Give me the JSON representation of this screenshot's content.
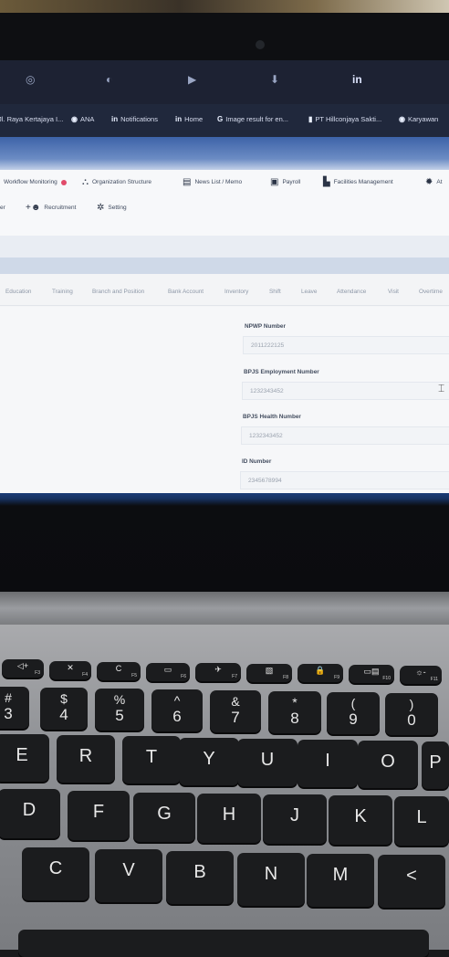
{
  "bookmarks": [
    {
      "icon": "pin-icon",
      "label": "Jl. Raya Kertajaya I..."
    },
    {
      "icon": "globe-icon",
      "label": "ANA"
    },
    {
      "icon": "linkedin-icon",
      "label": "Notifications"
    },
    {
      "icon": "linkedin-icon",
      "label": "Home"
    },
    {
      "icon": "google-icon",
      "label": "Image result for en..."
    },
    {
      "icon": "app-icon",
      "label": "PT Hillconjaya Sakti..."
    },
    {
      "icon": "globe-icon",
      "label": "Karyawan"
    }
  ],
  "menu": {
    "row1": [
      {
        "icon": "none",
        "label": "Workflow Monitoring"
      },
      {
        "icon": "org-chart-icon",
        "label": "Organization Structure"
      },
      {
        "icon": "news-icon",
        "label": "News List / Memo"
      },
      {
        "icon": "payroll-icon",
        "label": "Payroll"
      },
      {
        "icon": "facilities-icon",
        "label": "Facilities Management"
      },
      {
        "icon": "settings-icon",
        "label": "At"
      }
    ],
    "row2": [
      {
        "icon": "none",
        "label": "er"
      },
      {
        "icon": "add-user-icon",
        "label": "Recruitment"
      },
      {
        "icon": "gear-icon",
        "label": "Setting"
      }
    ]
  },
  "tabs": [
    "Education",
    "Training",
    "Branch and Position",
    "Bank Account",
    "Inventory",
    "Shift",
    "Leave",
    "Attendance",
    "Visit",
    "Overtime"
  ],
  "fields": [
    {
      "label": "NPWP Number",
      "value": "2011222125"
    },
    {
      "label": "BPJS Employment Number",
      "value": "1232343452"
    },
    {
      "label": "BPJS Health Number",
      "value": "1232343452"
    },
    {
      "label": "ID Number",
      "value": "2345678994"
    }
  ],
  "keyboard": {
    "fn_row": [
      {
        "sym": "◁+",
        "sub": "F3"
      },
      {
        "sym": "✕",
        "sub": "F4"
      },
      {
        "sym": "C",
        "sub": "F5"
      },
      {
        "sym": "▭",
        "sub": "F6"
      },
      {
        "sym": "✈",
        "sub": "F7"
      },
      {
        "sym": "▧",
        "sub": "F8"
      },
      {
        "sym": "🔒",
        "sub": "F9"
      },
      {
        "sym": "▭▤",
        "sub": "F10"
      },
      {
        "sym": "☼-",
        "sub": "F11"
      }
    ],
    "num_row": [
      {
        "top": "#",
        "bot": "3"
      },
      {
        "top": "$",
        "bot": "4"
      },
      {
        "top": "%",
        "bot": "5"
      },
      {
        "top": "^",
        "bot": "6"
      },
      {
        "top": "&",
        "bot": "7"
      },
      {
        "top": "*",
        "bot": "8"
      },
      {
        "top": "(",
        "bot": "9"
      },
      {
        "top": ")",
        "bot": "0"
      }
    ],
    "row_q": [
      "E",
      "R",
      "T",
      "Y",
      "U",
      "I",
      "O",
      "P"
    ],
    "row_a": [
      "D",
      "F",
      "G",
      "H",
      "J",
      "K",
      "L"
    ],
    "row_z": [
      "C",
      "V",
      "B",
      "N",
      "M",
      "<"
    ]
  }
}
